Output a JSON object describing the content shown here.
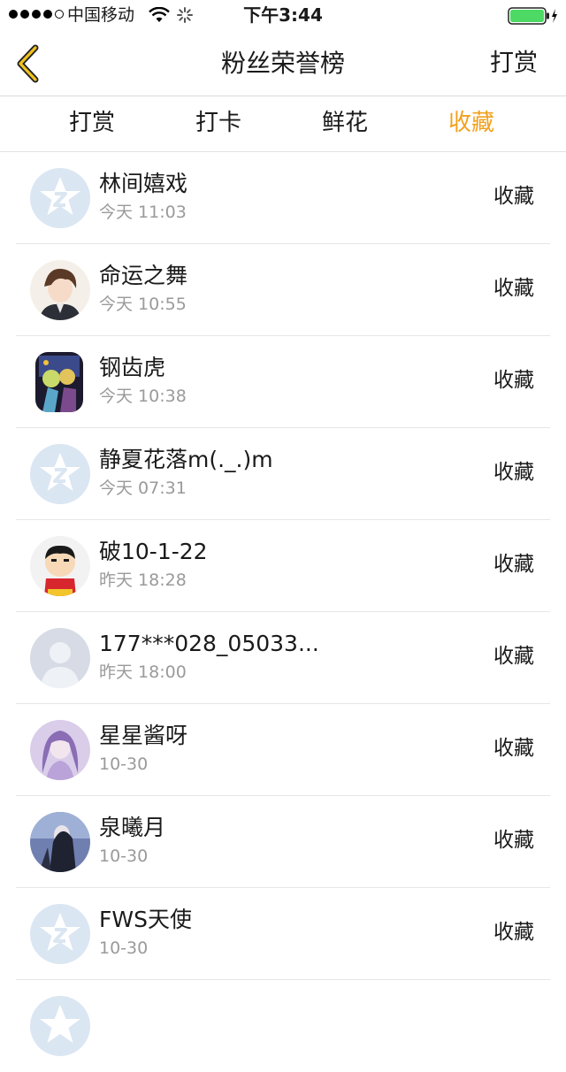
{
  "status_bar": {
    "carrier": "中国移动",
    "time": "下午3:44",
    "battery_color": "#4cd964"
  },
  "nav": {
    "title": "粉丝荣誉榜",
    "right_button": "打赏",
    "accent_color": "#f1a11e"
  },
  "tabs": [
    {
      "label": "打赏",
      "active": false
    },
    {
      "label": "打卡",
      "active": false
    },
    {
      "label": "鲜花",
      "active": false
    },
    {
      "label": "收藏",
      "active": true
    }
  ],
  "fans": [
    {
      "name": "林间嬉戏",
      "time": "今天 11:03",
      "action": "收藏",
      "avatar": "default-star-avatar"
    },
    {
      "name": "命运之舞",
      "time": "今天 10:55",
      "action": "收藏",
      "avatar": "anime-boy-avatar"
    },
    {
      "name": "钢齿虎",
      "time": "今天 10:38",
      "action": "收藏",
      "avatar": "anime-art-avatar"
    },
    {
      "name": "静夏花落m(._.)m",
      "time": "今天 07:31",
      "action": "收藏",
      "avatar": "default-star-avatar"
    },
    {
      "name": "破10-1-22",
      "time": "昨天 18:28",
      "action": "收藏",
      "avatar": "cartoon-kid-avatar"
    },
    {
      "name": "177***028_05033...",
      "time": "昨天 18:00",
      "action": "收藏",
      "avatar": "blank-person-avatar"
    },
    {
      "name": "星星酱呀",
      "time": "10-30",
      "action": "收藏",
      "avatar": "purple-anime-avatar"
    },
    {
      "name": "泉曦月",
      "time": "10-30",
      "action": "收藏",
      "avatar": "dark-anime-avatar"
    },
    {
      "name": "FWS天使",
      "time": "10-30",
      "action": "收藏",
      "avatar": "default-star-avatar"
    }
  ]
}
